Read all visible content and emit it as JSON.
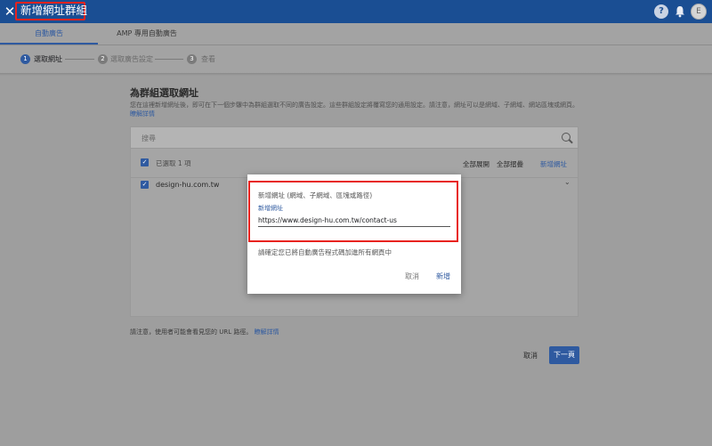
{
  "header": {
    "close_icon": "close-icon",
    "title": "新增網址群組",
    "help_icon": "help-icon",
    "notifications_icon": "bell-icon",
    "avatar_initial": "E"
  },
  "tabs": [
    {
      "label": "自動廣告",
      "active": true
    },
    {
      "label": "AMP 專用自動廣告",
      "active": false
    }
  ],
  "stepper": [
    {
      "number": "1",
      "label": "選取網址",
      "active": true
    },
    {
      "number": "2",
      "label": "選取廣告設定",
      "active": false
    },
    {
      "number": "3",
      "label": "查看",
      "active": false
    }
  ],
  "main": {
    "heading": "為群組選取網址",
    "description": "您在這裡新增網址後，即可在下一個步驟中為群組選取不同的廣告設定。這些群組設定將覆寫您的通用設定。請注意，網址可以是網域、子網域、網站區塊或網頁。",
    "learn_more": "瞭解詳情",
    "search_placeholder": "搜尋",
    "selected_count": "已選取 1 項",
    "expand_all": "全部展開",
    "collapse_all": "全部摺疊",
    "add_url": "新增網址",
    "url_items": [
      "design-hu.com.tw"
    ],
    "note": "請注意，使用者可能會看見您的 URL 路徑。",
    "note_link": "瞭解詳情",
    "cancel": "取消",
    "next": "下一頁"
  },
  "dialog": {
    "label": "新增網址 (網域、子網域、區塊或路徑)",
    "field_label": "新增網址",
    "field_value": "https://www.design-hu.com.tw/contact-us",
    "hint": "請確定您已將自動廣告程式碼加進所有網頁中",
    "cancel": "取消",
    "add": "新增"
  },
  "colors": {
    "brand_blue": "#1a4e93",
    "accent_blue": "#2f5aa0",
    "highlight_red": "#e8231f"
  }
}
